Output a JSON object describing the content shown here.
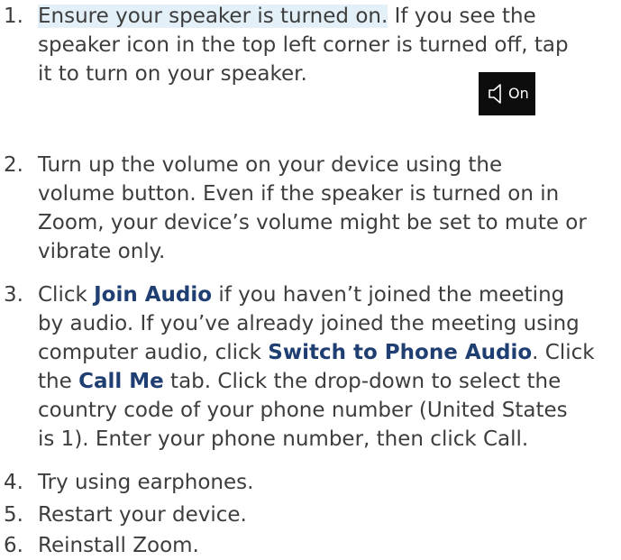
{
  "steps": [
    {
      "num": "1.",
      "highlight": "Ensure your speaker is turned on.",
      "rest": " If you see the",
      "line2": "speaker icon in the top left corner is turned off, tap",
      "line3": "it to turn on your speaker.",
      "badge": {
        "icon": "speaker-icon",
        "label": "On",
        "bg": "#0d0d0d"
      }
    },
    {
      "num": "2.",
      "lines": [
        "Turn up the volume on your device using the",
        "volume button. Even if the speaker is turned on in",
        "Zoom, your device’s volume might be set to mute or",
        "vibrate only."
      ]
    },
    {
      "num": "3.",
      "l1a": "Click ",
      "l1b": "Join Audio",
      "l1c": " if you haven’t joined the meeting",
      "l2": "by audio. If you’ve already joined the meeting using",
      "l3a": "computer audio, click ",
      "l3b": "Switch to Phone Audio",
      "l3c": ". Click",
      "l4a": "the ",
      "l4b": "Call Me",
      "l4c": " tab. Click the drop-down to select the",
      "l5": "country code of your phone number (United States",
      "l6": "is 1). Enter your phone number, then click Call."
    },
    {
      "num": "4.",
      "text": "Try using earphones."
    },
    {
      "num": "5.",
      "text": "Restart your device."
    },
    {
      "num": "6.",
      "text": "Reinstall Zoom."
    }
  ],
  "colors": {
    "text": "#3d3d3d",
    "bold": "#1f3f73",
    "highlight": "#e3f0f8"
  }
}
